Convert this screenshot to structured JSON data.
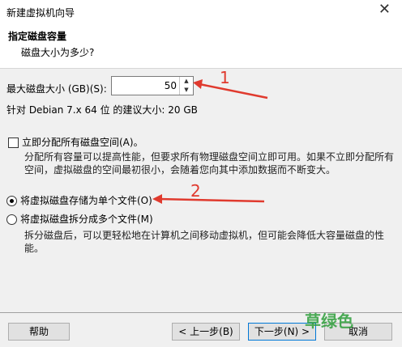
{
  "window": {
    "title": "新建虚拟机向导",
    "close_glyph": "✕"
  },
  "header": {
    "title": "指定磁盘容量",
    "subtitle": "磁盘大小为多少?"
  },
  "max_disk": {
    "label": "最大磁盘大小 (GB)(S):",
    "value": "50"
  },
  "recommend_text": "针对 Debian 7.x 64 位 的建议大小: 20 GB",
  "allocate": {
    "label": "立即分配所有磁盘空间(A)。",
    "checked": false,
    "description_line1": "分配所有容量可以提高性能，但要求所有物理磁盘空间立即可用。如果不立即分配所有",
    "description_line2": "空间，虚拟磁盘的空间最初很小，会随着您向其中添加数据而不断变大。"
  },
  "storage_options": {
    "single": {
      "label": "将虚拟磁盘存储为单个文件(O)",
      "selected": true
    },
    "multiple": {
      "label": "将虚拟磁盘拆分成多个文件(M)",
      "selected": false,
      "description_line1": "拆分磁盘后，可以更轻松地在计算机之间移动虚拟机，但可能会降低大容量磁盘的性",
      "description_line2": "能。"
    }
  },
  "buttons": {
    "help": "帮助",
    "back": "< 上一步(B)",
    "next": "下一步(N) >",
    "cancel": "取消"
  },
  "annotations": {
    "one": "1",
    "two": "2",
    "color": "#e03a2e"
  },
  "watermark": "草绿色"
}
